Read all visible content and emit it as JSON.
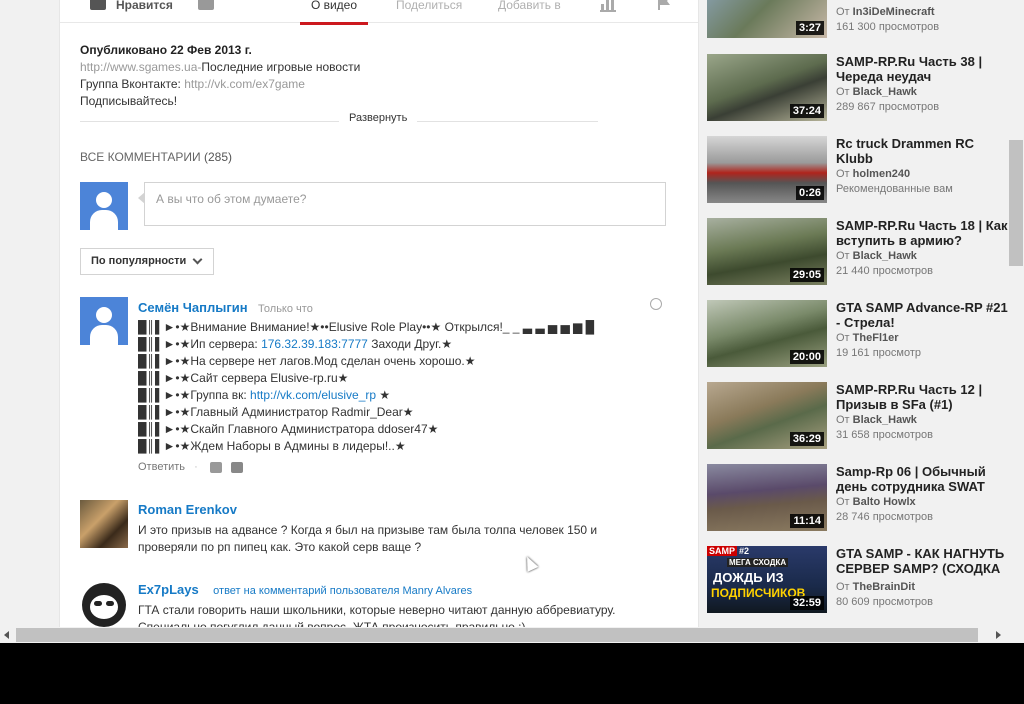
{
  "actions": {
    "like_label": "Нравится",
    "tab_about": "О видео",
    "tab_share": "Поделиться",
    "tab_add": "Добавить в"
  },
  "description": {
    "published": "Опубликовано 22 Фев 2013 г.",
    "site_url": "http://www.sgames.ua",
    "site_sep": "-",
    "site_text": "Последние игровые новости",
    "vk_prefix": "Группа Вконтакте: ",
    "vk_url": "http://vk.com/ex7game",
    "subscribe": "Подписывайтесь!",
    "expand_label": "Развернуть"
  },
  "comments": {
    "header": "ВСЕ КОММЕНТАРИИ",
    "count": "(285)",
    "input_placeholder": "А вы что об этом думаете?",
    "sort_label": "По популярности",
    "items": [
      {
        "author": "Семён Чаплыгин",
        "time": "Только что",
        "lines": [
          "█║▌►•★Внимание Внимание!★••Elusive Role Play••★ Открылся!_ _ ▃ ▃ ▅ ▅ ▆ █",
          "█║▌►•★Ип сервера: ",
          "█║▌►•★На сервере нет лагов.Мод сделан очень хорошо.★",
          "█║▌►•★Сайт сервера Elusive-rp.ru★",
          "█║▌►•★Группа вк: ",
          "█║▌►•★Главный Администратор Radmir_Dear★",
          "█║▌►•★Скайп Главного Администратора ddoser47★",
          "█║▌►•★Ждем Наборы в Админы в лидеры!..★"
        ],
        "server_ip": "176.32.39.183:7777",
        "server_ip_suffix": " Заходи Друг.★",
        "vk_link": "http://vk.com/elusive_rp",
        "vk_suffix": " ★",
        "reply_label": "Ответить",
        "sep": "·"
      },
      {
        "author": "Roman Erenkov",
        "text1": "И это призыв на адвансе ? Когда я был на призыве там была толпа человек 150 и",
        "text2": "проверяли по рп пипец как. Это какой серв ваще ?"
      },
      {
        "author": "Ex7pLays",
        "reply_to": "ответ на комментарий пользователя Manry Alvares",
        "text1": "ГТА стали говорить наши школьники, которые неверно читают данную аббревиатуру.",
        "text2": "Специально погуглил данный вопрос. ЖТА произносить правильно :)"
      }
    ]
  },
  "sidebar": {
    "from_label": "От",
    "videos": [
      {
        "title1": "",
        "title2": "",
        "channel": "In3iDeMinecraft",
        "views": "161 300 просмотров",
        "duration": "3:27"
      },
      {
        "title1": "SAMP-RP.Ru Часть 38 |",
        "title2": "Череда неудач",
        "channel": "Black_Hawk",
        "views": "289 867 просмотров",
        "duration": "37:24"
      },
      {
        "title1": "Rc truck Drammen RC",
        "title2": "Klubb",
        "channel": "holmen240",
        "views": "Рекомендованные вам",
        "duration": "0:26"
      },
      {
        "title1": "SAMP-RP.Ru Часть 18 | Как",
        "title2": "вступить в армию?",
        "channel": "Black_Hawk",
        "views": "21 440 просмотров",
        "duration": "29:05"
      },
      {
        "title1": "GTA SAMP Advance-RP #21",
        "title2": "- Стрела!",
        "channel": "TheFl1er",
        "views": "19 161 просмотр",
        "duration": "20:00"
      },
      {
        "title1": "SAMP-RP.Ru Часть 12 |",
        "title2": "Призыв в SFa (#1)",
        "channel": "Black_Hawk",
        "views": "31 658 просмотров",
        "duration": "36:29"
      },
      {
        "title1": "Samp-Rp 06 | Обычный",
        "title2": "день сотрудника SWAT",
        "channel": "Balto Howlx",
        "views": "28 746 просмотров",
        "duration": "11:14"
      },
      {
        "title1": "GTA SAMP - КАК НАГНУТЬ",
        "title2": "СЕРВЕР SAMP? (СХОДКА",
        "channel": "TheBrainDit",
        "views": "80 609 просмотров",
        "duration": "32:59"
      }
    ],
    "last_thumb_badge": "SAMP",
    "last_thumb_badge2": "#2",
    "last_thumb_text1": "МЕГА СХОДКА",
    "last_thumb_text2": "ДОЖДЬ ИЗ",
    "last_thumb_text3": "ПОДПИСЧИКОВ"
  }
}
